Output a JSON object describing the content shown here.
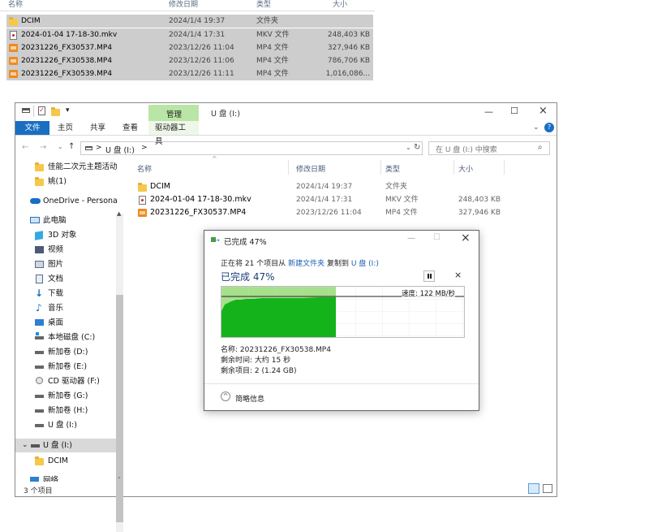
{
  "colors": {
    "accent": "#1a6ec2",
    "progress_fill": "#a6e08b",
    "progress_dark": "#14b31c",
    "manage_tab": "#b9e6a6"
  },
  "bg_list": {
    "headers": {
      "name": "名称",
      "date": "修改日期",
      "type": "类型",
      "size": "大小"
    },
    "rows": [
      {
        "icon": "folder-icon",
        "name": "DCIM",
        "date": "2024/1/4 19:37",
        "type": "文件夹",
        "size": ""
      },
      {
        "icon": "mkv-file-icon",
        "name": "2024-01-04 17-18-30.mkv",
        "date": "2024/1/4 17:31",
        "type": "MKV 文件",
        "size": "248,403 KB"
      },
      {
        "icon": "mp4-file-icon",
        "name": "20231226_FX30537.MP4",
        "date": "2023/12/26 11:04",
        "type": "MP4 文件",
        "size": "327,946 KB"
      },
      {
        "icon": "mp4-file-icon",
        "name": "20231226_FX30538.MP4",
        "date": "2023/12/26 11:06",
        "type": "MP4 文件",
        "size": "786,706 KB"
      },
      {
        "icon": "mp4-file-icon",
        "name": "20231226_FX30539.MP4",
        "date": "2023/12/26 11:11",
        "type": "MP4 文件",
        "size": "1,016,086..."
      }
    ]
  },
  "explorer": {
    "context_tab": "管理",
    "title": "U 盘 (I:)",
    "tabs": {
      "file": "文件",
      "home": "主页",
      "share": "共享",
      "view": "查看",
      "drive_tools": "驱动器工具"
    },
    "address": {
      "sep1": ">",
      "location": "U 盘 (I:)",
      "sep2": ">"
    },
    "search_placeholder": "在 U 盘 (I:) 中搜索",
    "sidebar": [
      {
        "icon": "folder-icon",
        "label": "佳能二次元主题活动"
      },
      {
        "icon": "folder-icon",
        "label": "姚(1)"
      },
      {
        "icon": "onedrive-icon",
        "label": "OneDrive - Persona"
      },
      {
        "icon": "pc-icon",
        "label": "此电脑"
      },
      {
        "icon": "3d-objects-icon",
        "label": "3D 对象"
      },
      {
        "icon": "video-icon",
        "label": "视频"
      },
      {
        "icon": "pictures-icon",
        "label": "图片"
      },
      {
        "icon": "documents-icon",
        "label": "文档"
      },
      {
        "icon": "downloads-icon",
        "label": "下载"
      },
      {
        "icon": "music-icon",
        "label": "音乐"
      },
      {
        "icon": "desktop-icon",
        "label": "桌面"
      },
      {
        "icon": "windows-drive-icon",
        "label": "本地磁盘 (C:)"
      },
      {
        "icon": "drive-icon",
        "label": "新加卷 (D:)"
      },
      {
        "icon": "drive-icon",
        "label": "新加卷 (E:)"
      },
      {
        "icon": "cd-drive-icon",
        "label": "CD 驱动器 (F:)"
      },
      {
        "icon": "drive-icon",
        "label": "新加卷 (G:)"
      },
      {
        "icon": "drive-icon",
        "label": "新加卷 (H:)"
      },
      {
        "icon": "drive-icon",
        "label": "U 盘 (I:)"
      },
      {
        "icon": "drive-icon",
        "label": "U 盘 (I:)"
      },
      {
        "icon": "folder-icon",
        "label": "DCIM"
      },
      {
        "icon": "network-icon",
        "label": "网络"
      }
    ],
    "columns": {
      "name": "名称",
      "date": "修改日期",
      "type": "类型",
      "size": "大小"
    },
    "files": [
      {
        "icon": "folder-icon",
        "name": "DCIM",
        "date": "2024/1/4 19:37",
        "type": "文件夹",
        "size": ""
      },
      {
        "icon": "mkv-file-icon",
        "name": "2024-01-04 17-18-30.mkv",
        "date": "2024/1/4 17:31",
        "type": "MKV 文件",
        "size": "248,403 KB"
      },
      {
        "icon": "mp4-file-icon",
        "name": "20231226_FX30537.MP4",
        "date": "2023/12/26 11:04",
        "type": "MP4 文件",
        "size": "327,946 KB"
      }
    ],
    "status": "3 个项目"
  },
  "dialog": {
    "title": "已完成 47%",
    "line1_pre": "正在将 21 个项目从",
    "line1_src": "新建文件夹",
    "line1_mid": "复制到",
    "line1_dst": "U 盘 (I:)",
    "percent_text": "已完成 47%",
    "progress": 0.47,
    "speed": "速度: 122 MB/秒",
    "name_line": "名称: 20231226_FX30538.MP4",
    "time_line": "剩余时间: 大约 15 秒",
    "items_line": "剩余项目: 2 (1.24 GB)",
    "details_toggle": "简略信息"
  }
}
